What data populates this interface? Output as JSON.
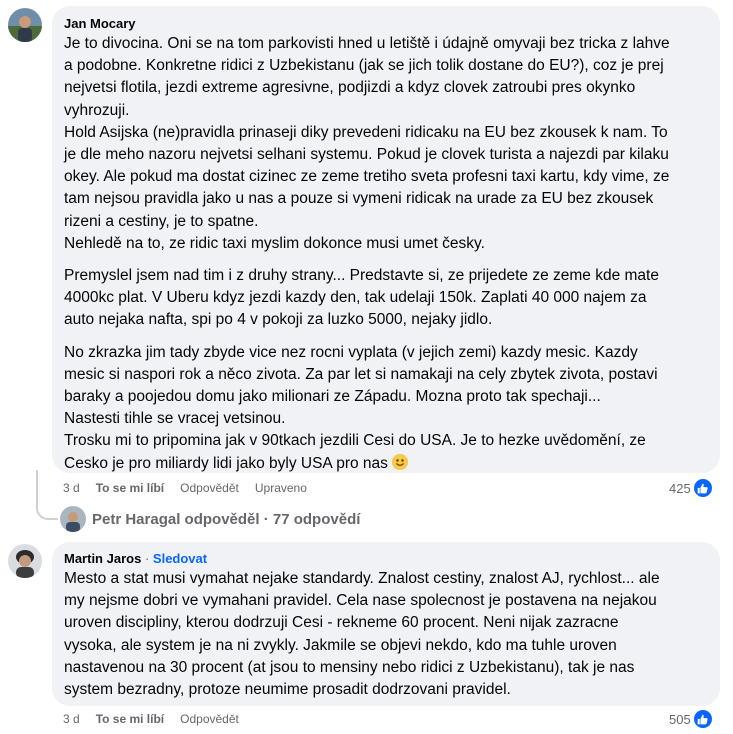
{
  "comments": [
    {
      "author": "Jan Mocary",
      "paragraphs": [
        [
          "Je to divocina. Oni se na tom parkovisti hned u letiště i údajně omyvaji bez tricka z lahve",
          "a podobne. Konkretne ridici z Uzbekistanu (jak se jich tolik dostane do EU?), coz je prej",
          "nejvetsi flotila, jezdi extreme agresivne, podjizdi a kdyz clovek zatroubi pres okynko",
          "vyhrozuji.",
          "Hold Asijska (ne)pravidla prinaseji diky prevedeni ridicaku na EU bez zkousek k nam. To",
          "je dle meho nazoru nejvetsi selhani systemu. Pokud je clovek turista a najezdi par kilaku",
          "okey. Ale pokud ma dostat cizinec ze zeme tretiho sveta profesni taxi kartu, kdy vime, ze",
          "tam nejsou pravidla jako u nas a pouze si vymeni ridicak na urade za EU bez zkousek",
          "rizeni a cestiny, je to spatne.",
          "Nehledě na to, ze ridic taxi myslim dokonce musi umet česky."
        ],
        [
          "Premyslel jsem nad tim i z druhy strany... Predstavte si, ze prijedete ze zeme kde mate",
          "4000kc plat. V Uberu kdyz jezdi kazdy den, tak udelaji 150k. Zaplati 40 000 najem za",
          "auto nejaka nafta, spi po 4 v pokoji za luzko 5000, nejaky jidlo."
        ],
        [
          "No zkrazka jim tady zbyde vice nez rocni vyplata (v jejich zemi) kazdy mesic. Kazdy",
          "mesic si naspori rok a něco zivota. Za par let si namakaji na cely zbytek zivota, postavi",
          "baraky a poojedou domu jako milionari ze Západu. Mozna proto tak spechaji...",
          "Nastesti tihle se vracej vetsinou.",
          "Trosku mi to pripomina jak v 90tkach jezdili Cesi do USA. Je to hezke uvědomění, ze",
          "Cesko je pro miliardy lidi jako byly USA pro nas"
        ]
      ],
      "time": "3 d",
      "like_label": "To se mi líbí",
      "reply_label": "Odpovědět",
      "edited_label": "Upraveno",
      "reaction_count": "425",
      "replies_summary": "Petr Haragal odpověděl · 77 odpovědí",
      "emoji": "smiley-emoji"
    },
    {
      "author": "Martin Jaros",
      "separator": "·",
      "follow_label": "Sledovat",
      "paragraphs": [
        [
          "Mesto a stat musi vymahat nejake standardy. Znalost cestiny, znalost AJ, rychlost... ale",
          "my nejsme dobri ve vymahani pravidel. Cela nase spolecnost je postavena na nejakou",
          "uroven discipliny, kterou dodrzuji Cesi - rekneme 60 procent. Neni nijak zazracne",
          "vysoka, ale system je na ni zvykly. Jakmile se objevi nekdo, kdo ma tuhle uroven",
          "nastavenou na 30 procent (at jsou to mensiny nebo ridici z Uzbekistanu), tak je nas",
          "system bezradny, protoze neumime prosadit dodrzovani pravidel."
        ]
      ],
      "time": "3 d",
      "like_label": "To se mi líbí",
      "reply_label": "Odpovědět",
      "reaction_count": "505"
    }
  ],
  "colors": {
    "bubble": "#f0f2f5",
    "link_blue": "#0866ff",
    "meta_gray": "#65676b",
    "text": "#050505"
  }
}
